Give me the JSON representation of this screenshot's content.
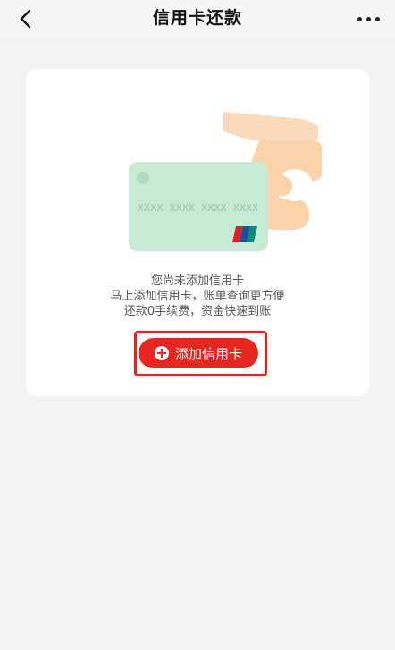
{
  "header": {
    "title": "信用卡还款",
    "back_icon": "chevron-left-icon",
    "more_icon": "more-horizontal-icon"
  },
  "card_placeholder": {
    "card_number_mask": "XXXX XXXX XXXX XXXX",
    "card_color": "#c7ead2",
    "hand_color": "#fbd2ad"
  },
  "empty_state": {
    "line1": "您尚未添加信用卡",
    "line2": "马上添加信用卡，账单查询更方便",
    "line3": "还款0手续费，资金快速到账"
  },
  "add_button": {
    "label": "添加信用卡",
    "icon": "plus-circle-icon",
    "color": "#e62721"
  }
}
